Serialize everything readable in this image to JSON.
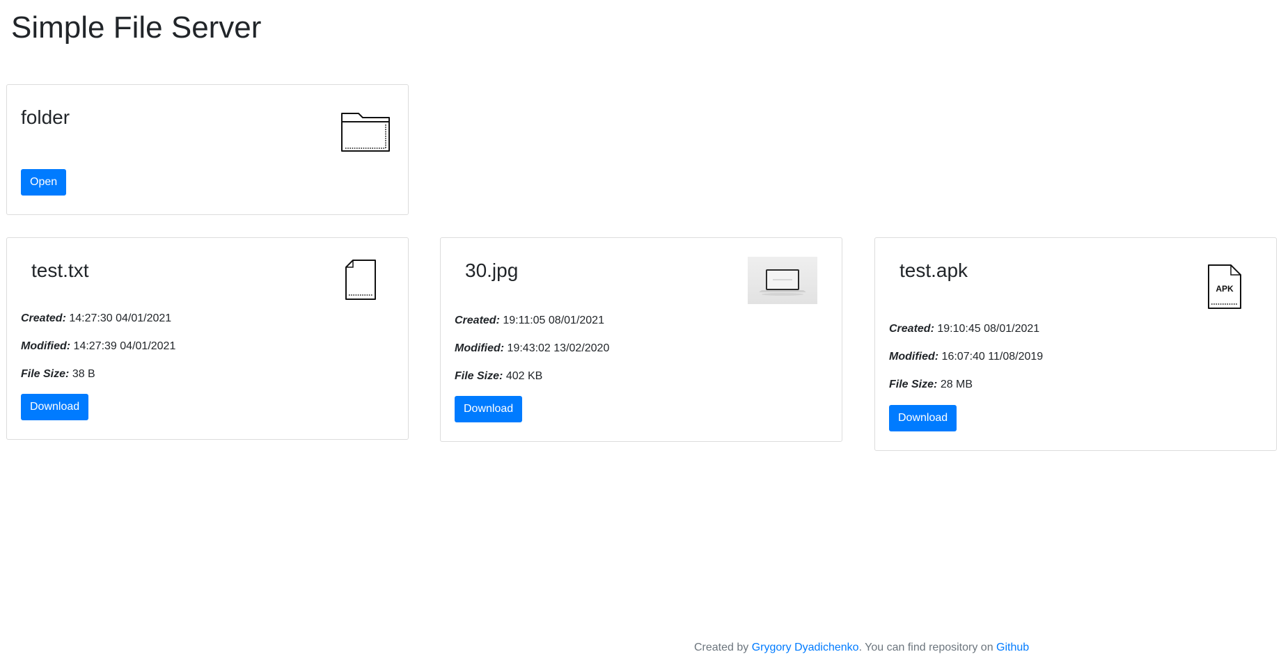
{
  "page": {
    "title": "Simple File Server"
  },
  "folder_card": {
    "name": "folder",
    "icon": "folder-icon",
    "open_label": "Open"
  },
  "file_cards": [
    {
      "name": "test.txt",
      "icon": "text-file-icon",
      "created_label": "Created:",
      "created_value": "14:27:30 04/01/2021",
      "modified_label": "Modified:",
      "modified_value": "14:27:39 04/01/2021",
      "size_label": "File Size:",
      "size_value": "38 B",
      "download_label": "Download"
    },
    {
      "name": "30.jpg",
      "icon": "image-thumbnail",
      "created_label": "Created:",
      "created_value": "19:11:05 08/01/2021",
      "modified_label": "Modified:",
      "modified_value": "19:43:02 13/02/2020",
      "size_label": "File Size:",
      "size_value": "402 KB",
      "download_label": "Download"
    },
    {
      "name": "test.apk",
      "icon": "apk-file-icon",
      "icon_text": "APK",
      "created_label": "Created:",
      "created_value": "19:10:45 08/01/2021",
      "modified_label": "Modified:",
      "modified_value": "16:07:40 11/08/2019",
      "size_label": "File Size:",
      "size_value": "28 MB",
      "download_label": "Download"
    }
  ],
  "footer": {
    "prefix": "Created by ",
    "author_link": "Grygory Dyadichenko",
    "middle": ". You can find repository on ",
    "repo_link": "Github"
  },
  "colors": {
    "primary": "#007bff",
    "text": "#212529",
    "muted": "#6c757d",
    "border": "#dcdcdc"
  }
}
